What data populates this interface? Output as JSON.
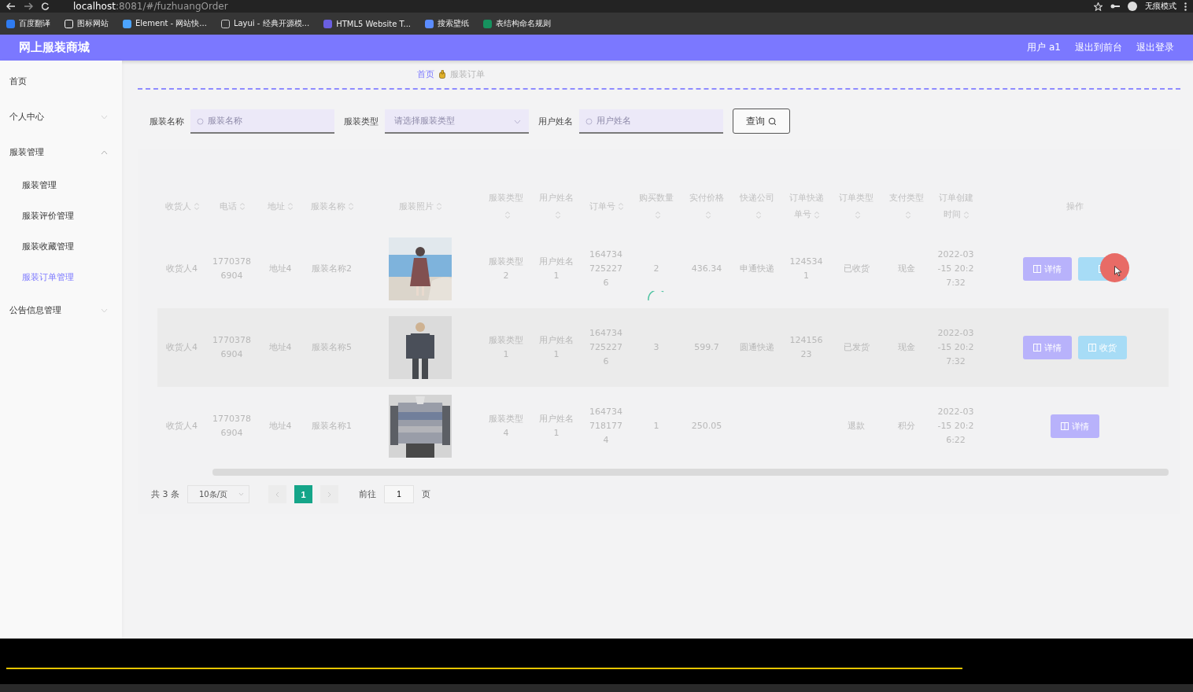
{
  "browser": {
    "url_host": "localhost",
    "url_path": ":8081/#/fuzhuangOrder",
    "profile_label": "无痕模式",
    "bookmarks": [
      {
        "label": "百度翻译",
        "kind": "translate"
      },
      {
        "label": "图标网站",
        "kind": "flag"
      },
      {
        "label": "Element - 网站快...",
        "kind": "element"
      },
      {
        "label": "Layui - 经典开源模...",
        "kind": "layui"
      },
      {
        "label": "HTML5 Website T...",
        "kind": "html5"
      },
      {
        "label": "搜索壁纸",
        "kind": "wallpaper"
      },
      {
        "label": "表结构命名规则",
        "kind": "sheet"
      }
    ]
  },
  "header": {
    "title": "网上服装商城",
    "links": [
      "用户 a1",
      "退出到前台",
      "退出登录"
    ]
  },
  "sidebar": {
    "items": [
      {
        "label": "首页",
        "selected": false
      },
      {
        "label": "个人中心",
        "selected": false,
        "expanded": false
      },
      {
        "label": "服装管理",
        "selected": false,
        "expanded": true,
        "children": [
          {
            "label": "服装管理",
            "selected": false
          },
          {
            "label": "服装评价管理",
            "selected": false
          },
          {
            "label": "服装收藏管理",
            "selected": false
          },
          {
            "label": "服装订单管理",
            "selected": true
          }
        ]
      },
      {
        "label": "公告信息管理",
        "selected": false,
        "expanded": false
      }
    ]
  },
  "breadcrumb": [
    "首页",
    "服装订单"
  ],
  "search": {
    "fields": [
      {
        "label": "服装名称",
        "placeholder": "服装名称",
        "kind": "input"
      },
      {
        "label": "服装类型",
        "placeholder": "请选择服装类型",
        "kind": "select"
      },
      {
        "label": "用户姓名",
        "placeholder": "用户姓名",
        "kind": "input"
      }
    ],
    "button": "查询"
  },
  "loading": true,
  "table": {
    "columns": [
      {
        "label": "收货人",
        "sortable": true
      },
      {
        "label": "电话",
        "sortable": true
      },
      {
        "label": "地址",
        "sortable": true
      },
      {
        "label": "服装名称",
        "sortable": true
      },
      {
        "label": "服装照片",
        "sortable": true
      },
      {
        "label": "服装类型",
        "sortable": true
      },
      {
        "label": "用户姓名",
        "sortable": true
      },
      {
        "label": "订单号",
        "sortable": true
      },
      {
        "label": "购买数量",
        "sortable": true
      },
      {
        "label": "实付价格",
        "sortable": true
      },
      {
        "label": "快递公司",
        "sortable": true
      },
      {
        "label": "订单快递单号",
        "sortable": true
      },
      {
        "label": "订单类型",
        "sortable": true
      },
      {
        "label": "支付类型",
        "sortable": true
      },
      {
        "label": "订单创建时间",
        "sortable": true
      },
      {
        "label": "操作",
        "sortable": false
      }
    ],
    "rows": [
      {
        "highlighted": false,
        "cells": [
          "收货人4",
          "17703786904",
          "地址4",
          "服装名称2",
          {
            "kind": "picture"
          },
          "服装类型2",
          "用户姓名1",
          "1647347252276",
          "2",
          "436.34",
          "申通快递",
          "1245341",
          "已收货",
          "现金",
          "2022-03-15 20:27:32"
        ],
        "actions": [
          {
            "kind": "detail",
            "label": "详情",
            "cursor": false
          },
          {
            "kind": "receive",
            "cursor": true
          }
        ]
      },
      {
        "highlighted": true,
        "cells": [
          "收货人4",
          "17703786904",
          "地址4",
          "服装名称5",
          {
            "kind": "picture"
          },
          "服装类型1",
          "用户姓名1",
          "1647347252276",
          "3",
          "599.7",
          "圆通快递",
          "12415623",
          "已发货",
          "现金",
          "2022-03-15 20:27:32"
        ],
        "actions": [
          {
            "kind": "detail",
            "label": "详情",
            "cursor": false
          },
          {
            "kind": "receive",
            "label": "收货",
            "cursor": false
          }
        ]
      },
      {
        "highlighted": false,
        "cells": [
          "收货人4",
          "17703786904",
          "地址4",
          "服装名称1",
          {
            "kind": "picture"
          },
          "服装类型4",
          "用户姓名1",
          "1647347181774",
          "1",
          "250.05",
          null,
          null,
          "退款",
          "积分",
          "2022-03-15 20:26:22"
        ],
        "actions": [
          {
            "kind": "detail",
            "label": "详情",
            "cursor": false
          }
        ]
      }
    ]
  },
  "pagination": {
    "total": "共 3 条",
    "page_size": "10条/页",
    "pages": [
      {
        "label": "1",
        "selected": true
      }
    ],
    "goto_label": "前往",
    "goto_value": "1",
    "page_unit": "页"
  },
  "video": {
    "level": 0.81
  }
}
